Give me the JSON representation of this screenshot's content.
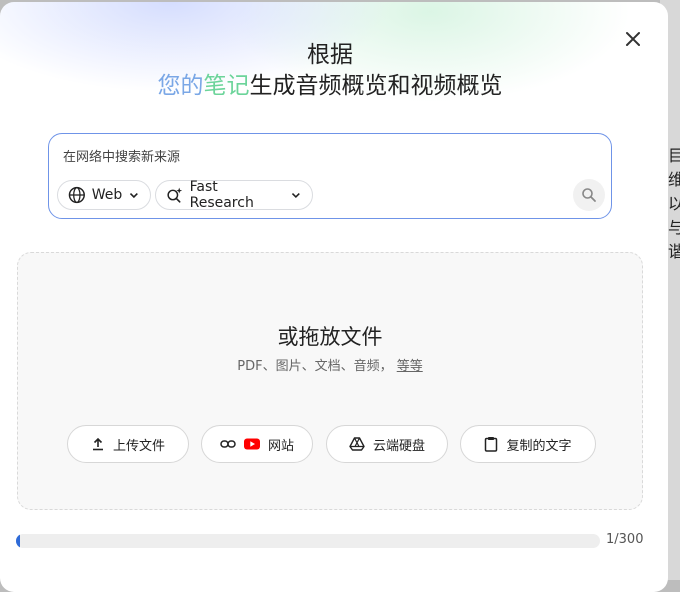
{
  "background_window": {
    "chars": [
      "目",
      "维",
      "以",
      "与",
      "谐"
    ]
  },
  "dialog": {
    "title_line1": "根据",
    "title_hl1": "您的",
    "title_hl2": "笔记",
    "title_rest": "生成音频概览和视频概览"
  },
  "search": {
    "placeholder": "在网络中搜索新来源",
    "value": "",
    "source_label": "Web",
    "mode_label": "Fast Research"
  },
  "drop_zone": {
    "title": "或拖放文件",
    "subtitle": "PDF、图片、文档、音频，",
    "more_link": "等等",
    "buttons": {
      "upload": "上传文件",
      "website": "网站",
      "drive": "云端硬盘",
      "paste": "复制的文字"
    }
  },
  "progress": {
    "current": 1,
    "max": 300,
    "label": "1/300"
  },
  "colors": {
    "accent_blue": "#6f94e8",
    "highlight_blue": "#7aa7e6",
    "highlight_green": "#6cd49a",
    "youtube_red": "#ff0000"
  },
  "icons": [
    "close-icon",
    "globe-icon",
    "chevron-down-icon",
    "sparkle-search-icon",
    "search-icon",
    "upload-icon",
    "link-icon",
    "youtube-icon",
    "drive-icon",
    "clipboard-icon"
  ]
}
